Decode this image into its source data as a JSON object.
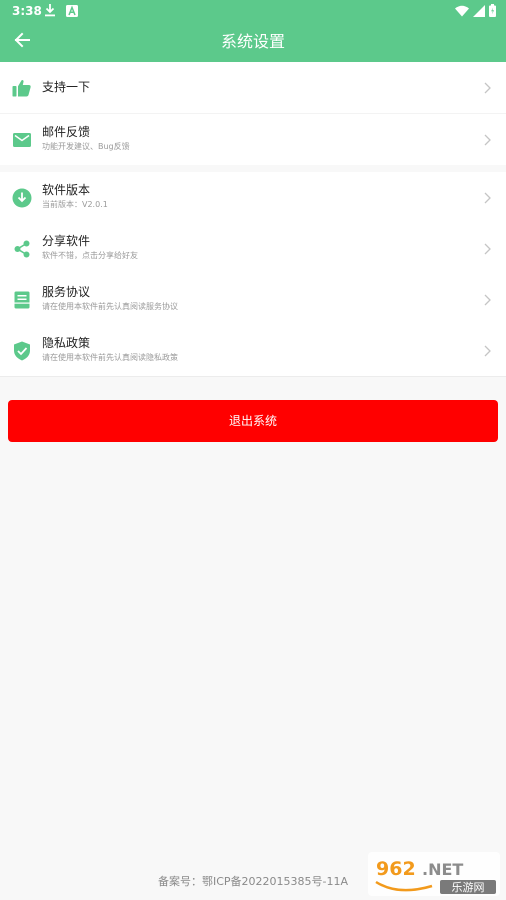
{
  "status_bar": {
    "time": "3:38",
    "icons": [
      "download-icon",
      "a-icon",
      "wifi-icon",
      "signal-icon",
      "battery-icon"
    ]
  },
  "app_bar": {
    "title": "系统设置",
    "back_icon": "arrow-left-icon"
  },
  "settings": {
    "support": {
      "icon": "thumbs-up-icon",
      "title": "支持一下"
    },
    "feedback": {
      "icon": "mail-icon",
      "title": "邮件反馈",
      "subtitle": "功能开发建议、Bug反馈"
    },
    "version": {
      "icon": "download-circle-icon",
      "title": "软件版本",
      "subtitle": "当前版本：V2.0.1"
    },
    "share": {
      "icon": "share-icon",
      "title": "分享软件",
      "subtitle": "软件不错，点击分享给好友"
    },
    "terms": {
      "icon": "document-icon",
      "title": "服务协议",
      "subtitle": "请在使用本软件前先认真阅读服务协议"
    },
    "privacy": {
      "icon": "shield-check-icon",
      "title": "隐私政策",
      "subtitle": "请在使用本软件前先认真阅读隐私政策"
    }
  },
  "logout": {
    "label": "退出系统"
  },
  "footer": {
    "icp": "备案号：鄂ICP备2022015385号-11A"
  },
  "watermark": {
    "logo_text": "962.NET",
    "site_name": "乐游网"
  },
  "colors": {
    "accent": "#5cc98b",
    "danger": "#ff0000",
    "background": "#f8f8f8"
  }
}
